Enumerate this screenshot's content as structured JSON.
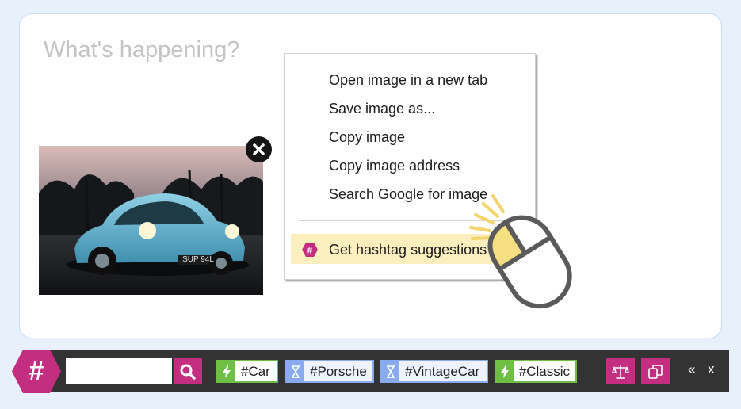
{
  "composer": {
    "placeholder": "What's happening?",
    "image_plate_text": "SUP 94L",
    "remove_icon": "close-x-icon"
  },
  "context_menu": {
    "items": [
      "Open image in a new tab",
      "Save image as...",
      "Copy image",
      "Copy image address",
      "Search Google for image"
    ],
    "highlighted_item": "Get hashtag suggestions",
    "highlight_icon": "hashtag-hexagon-icon"
  },
  "toolbar": {
    "logo_symbol": "#",
    "search_value": "",
    "search_icon": "magnifier-icon",
    "tags": [
      {
        "label": "#Car",
        "kind": "trending",
        "icon": "lightning-icon"
      },
      {
        "label": "#Porsche",
        "kind": "pending",
        "icon": "hourglass-icon"
      },
      {
        "label": "#VintageCar",
        "kind": "pending",
        "icon": "hourglass-icon"
      },
      {
        "label": "#Classic",
        "kind": "trending",
        "icon": "lightning-icon"
      }
    ],
    "collapse_label": "«",
    "close_label": "x"
  },
  "colors": {
    "brand": "#c42e80",
    "trending": "#6fbf44",
    "pending": "#8aaaf0",
    "highlight": "#fbefbf",
    "toolbar_bg": "#333333"
  }
}
